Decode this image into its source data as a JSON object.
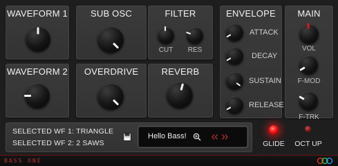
{
  "panels": {
    "waveform1": "WAVEFORM 1",
    "sub_osc": "SUB OSC",
    "filter": "FILTER",
    "envelope": "ENVELOPE",
    "main": "MAIN",
    "waveform2": "WAVEFORM 2",
    "overdrive": "OVERDRIVE",
    "reverb": "REVERB"
  },
  "filter_labels": {
    "cut": "CUT",
    "res": "RES"
  },
  "envelope_labels": {
    "attack": "ATTACK",
    "decay": "DECAY",
    "sustain": "SUSTAIN",
    "release": "RELEASE"
  },
  "main_labels": {
    "vol": "VOL",
    "fmod": "F-MOD",
    "ftrk": "F-TRK"
  },
  "info": {
    "wf1": "SELECTED WF 1:  TRIANGLE",
    "wf2": "SELECTED WF 2:  2 SAWS"
  },
  "display": {
    "text": "Hello Bass!",
    "icons": [
      "floppy-icon",
      "magnifier-icon",
      "prev-arrows-icon",
      "next-arrows-icon"
    ]
  },
  "buttons": {
    "glide": "GLIDE",
    "oct_up": "OCT UP"
  },
  "footer": {
    "brand": "BASS ONE"
  },
  "colors": {
    "accent": "#ff2020",
    "led_off": "#8a1a1a",
    "panel": "#363636"
  }
}
